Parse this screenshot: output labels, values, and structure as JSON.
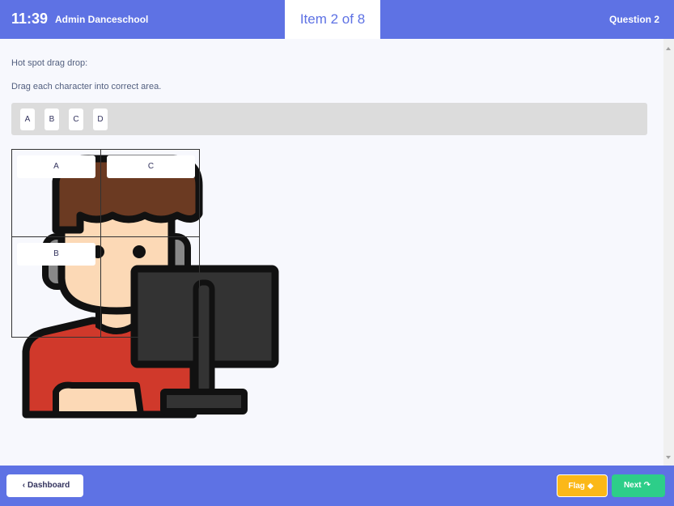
{
  "header": {
    "time": "11:39",
    "app_title": "Admin Danceschool",
    "item_counter": "Item 2 of 8",
    "question_label": "Question 2"
  },
  "question": {
    "type_label": "Hot spot drag drop:",
    "instruction": "Drag each character into correct area."
  },
  "tray": {
    "chips": [
      "A",
      "B",
      "C",
      "D"
    ]
  },
  "hotspot": {
    "placed": {
      "zone_top_left": "A",
      "zone_top_right": "C",
      "zone_bottom_left": "B"
    }
  },
  "footer": {
    "dashboard_label": "Dashboard",
    "flag_label": "Flag",
    "next_label": "Next"
  },
  "colors": {
    "accent": "#5e72e4",
    "flag": "#fbb818",
    "next": "#2dce89"
  },
  "icons": [
    "chevron-left-icon",
    "tag-icon",
    "share-arrow-icon"
  ]
}
